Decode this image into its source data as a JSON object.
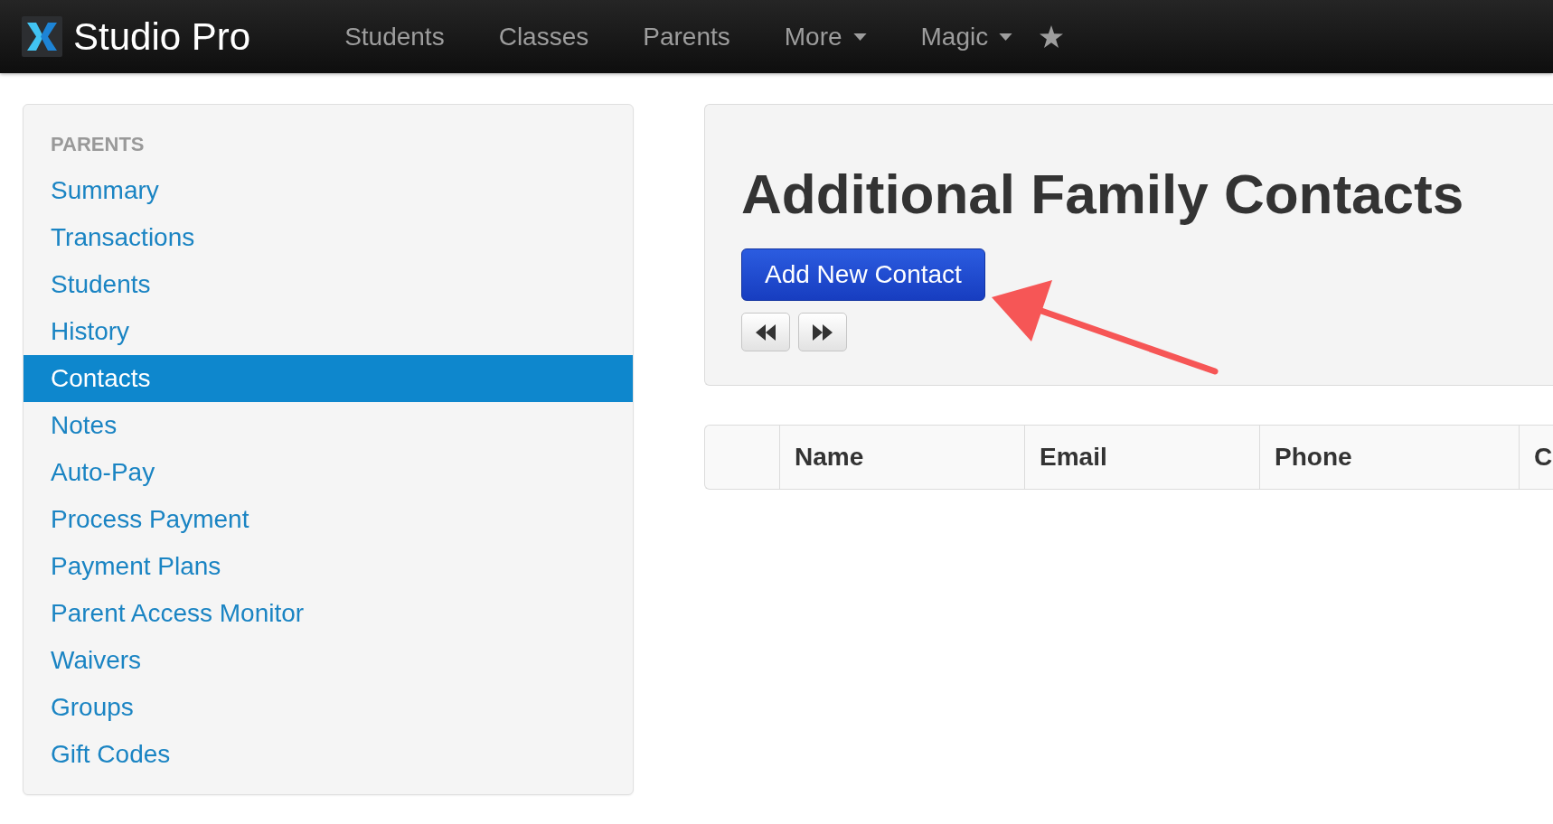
{
  "navbar": {
    "brand": "Studio Pro",
    "items": [
      {
        "kind": "link",
        "label": "Students"
      },
      {
        "kind": "link",
        "label": "Classes"
      },
      {
        "kind": "link",
        "label": "Parents"
      },
      {
        "kind": "dropdown",
        "label": "More"
      },
      {
        "kind": "dropdown",
        "label": "Magic"
      },
      {
        "kind": "star"
      }
    ]
  },
  "sidebar": {
    "heading": "PARENTS",
    "items": [
      {
        "label": "Summary",
        "selected": false
      },
      {
        "label": "Transactions",
        "selected": false
      },
      {
        "label": "Students",
        "selected": false
      },
      {
        "label": "History",
        "selected": false
      },
      {
        "label": "Contacts",
        "selected": true
      },
      {
        "label": "Notes",
        "selected": false
      },
      {
        "label": "Auto-Pay",
        "selected": false
      },
      {
        "label": "Process Payment",
        "selected": false
      },
      {
        "label": "Payment Plans",
        "selected": false
      },
      {
        "label": "Parent Access Monitor",
        "selected": false
      },
      {
        "label": "Waivers",
        "selected": false
      },
      {
        "label": "Groups",
        "selected": false
      },
      {
        "label": "Gift Codes",
        "selected": false
      }
    ]
  },
  "page": {
    "title": "Additional Family Contacts",
    "add_button": "Add New Contact",
    "pager": [
      {
        "kind": "previous"
      },
      {
        "kind": "next"
      }
    ]
  },
  "table": {
    "columns": [
      "Name",
      "Email",
      "Phone",
      "C"
    ]
  }
}
